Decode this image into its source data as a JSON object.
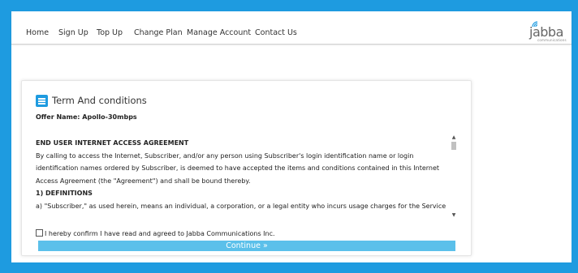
{
  "nav": {
    "items": [
      {
        "label": "Home"
      },
      {
        "label": "Sign Up"
      },
      {
        "label": "Top Up"
      },
      {
        "label": "Change Plan"
      },
      {
        "label": "Manage Account"
      },
      {
        "label": "Contact Us"
      }
    ]
  },
  "logo": {
    "word": "jabba",
    "sub": "communications",
    "icon": "wifi-waves-icon"
  },
  "card": {
    "icon": "list-icon",
    "title": "Term And conditions",
    "offer": "Offer Name: Apollo-30mbps",
    "terms": {
      "heading": "END USER INTERNET ACCESS AGREEMENT",
      "lines": [
        "By calling to access the Internet, Subscriber, and/or any person using Subscriber's login identification name or login",
        "identification names ordered by Subscriber, is deemed to have accepted the items and conditions contained in this Internet",
        "Access Agreement (the \"Agreement\") and shall be bound thereby."
      ],
      "section1": "1) DEFINITIONS",
      "section1_line": "a) \"Subscriber,\" as used herein, means an individual, a corporation, or a legal entity who incurs usage charges for the Service for"
    },
    "confirm_label": "I hereby confirm I have read and agreed to Jabba Communications Inc.",
    "confirm_checked": false,
    "continue_label": "Continue »"
  },
  "colors": {
    "accent": "#1e9be0",
    "button": "#5bc0ea"
  }
}
